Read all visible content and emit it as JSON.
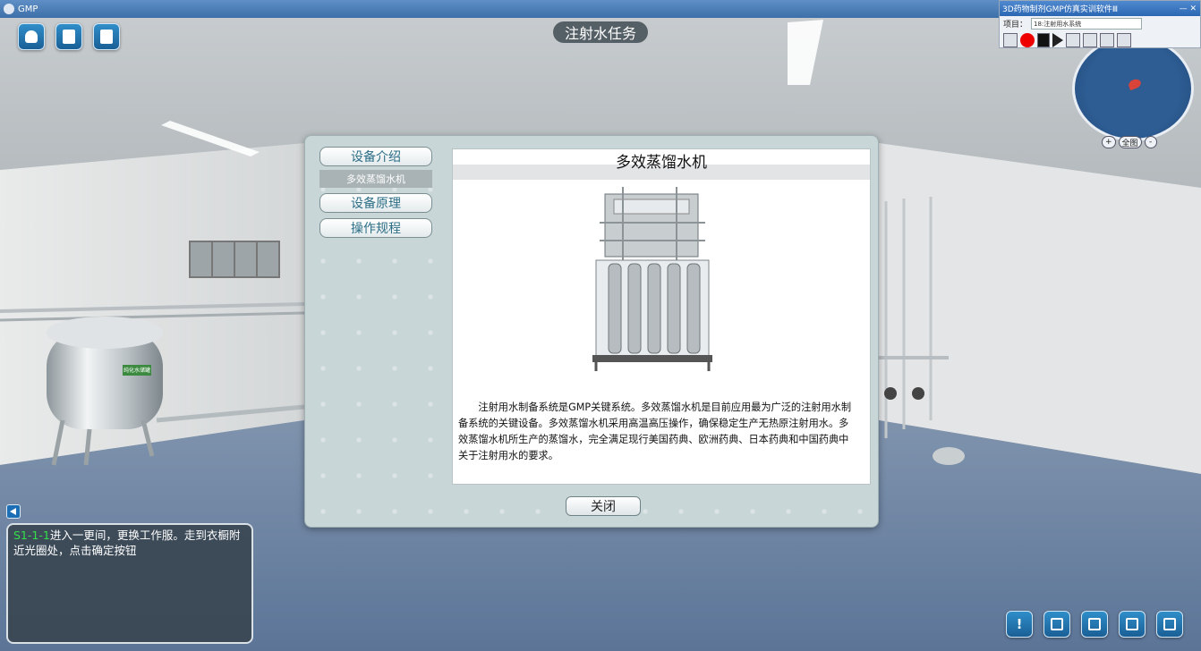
{
  "window": {
    "app_name": "GMP"
  },
  "mini_panel": {
    "title": "3D药物制剂GMP仿真实训软件Ⅲ",
    "controls": "— ✕",
    "project_label": "项目：",
    "project_value": "18:注射用水系统"
  },
  "minimap": {
    "zoom_in": "+",
    "full_view": "全图",
    "zoom_out": "-"
  },
  "task_title": "注射水任务",
  "dialog": {
    "nav": {
      "intro_label": "设备介绍",
      "intro_sub_item": "多效蒸馏水机",
      "principle_label": "设备原理",
      "procedure_label": "操作规程"
    },
    "content_title": "多效蒸馏水机",
    "content_text": "注射用水制备系统是GMP关键系统。多效蒸馏水机是目前应用最为广泛的注射用水制备系统的关键设备。多效蒸馏水机采用高温高压操作，确保稳定生产无热原注射用水。多效蒸馏水机所生产的蒸馏水，完全满足现行美国药典、欧洲药典、日本药典和中国药典中关于注射用水的要求。",
    "close_label": "关闭"
  },
  "task_panel": {
    "code": "S1-1-1",
    "text": "进入一更间，更换工作服。走到衣橱附近光圈处，点击确定按钮"
  },
  "scene": {
    "tank_label": "纯化水储罐"
  },
  "bottom_tools": {
    "alert_label": "!"
  }
}
